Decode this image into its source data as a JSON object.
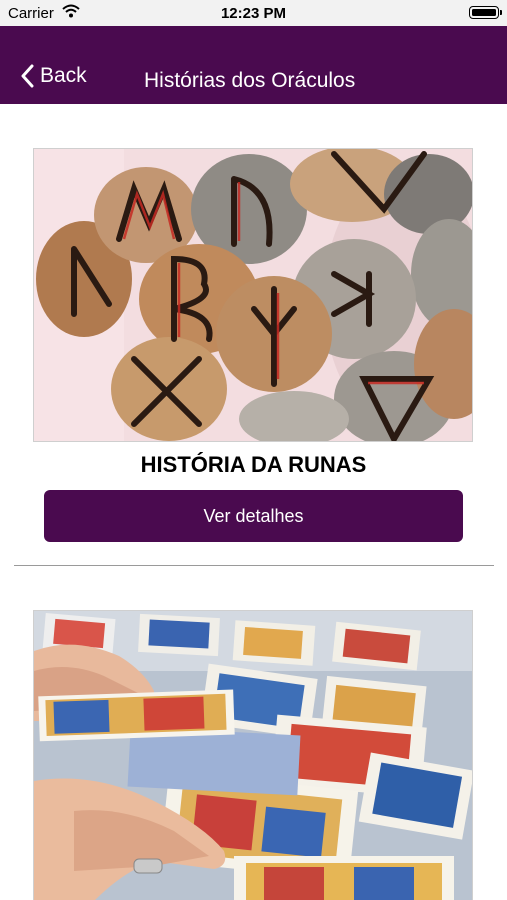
{
  "status_bar": {
    "carrier": "Carrier",
    "time": "12:23 PM"
  },
  "nav": {
    "back_label": "Back",
    "title": "Histórias dos Oráculos"
  },
  "cards": [
    {
      "title": "HISTÓRIA DA RUNAS",
      "button_label": "Ver detalhes",
      "image": "rune-stones-photo"
    },
    {
      "image": "tarot-cards-photo"
    }
  ],
  "colors": {
    "primary": "#4a0a4f",
    "background": "#ffffff"
  }
}
